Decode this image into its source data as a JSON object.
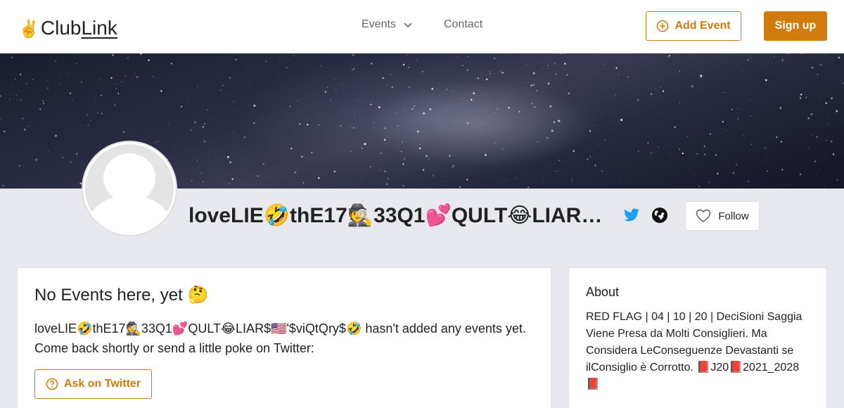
{
  "header": {
    "logo_emoji": "✌️",
    "logo_club": "Club",
    "logo_link": "Link",
    "nav_events": "Events",
    "nav_contact": "Contact",
    "add_event": "Add Event",
    "sign_up": "Sign up"
  },
  "profile": {
    "name": "loveLIE🤣thE17🕵️33Q1💕QULT😂LIAR$🇺🇸'$viQtQry$🤣",
    "follow_label": "Follow"
  },
  "events_card": {
    "title": "No Events here, yet 🤔",
    "message": "loveLIE🤣thE17🕵️33Q1💕QULT😂LIAR$🇺🇸'$viQtQry$🤣 hasn't added any events yet. Come back shortly or send a little poke on Twitter:",
    "ask_button": "Ask on Twitter"
  },
  "about_card": {
    "title": "About",
    "text": "RED FLAG | 04 | 10 | 20 | DeciSioni Saggia Viene Presa da Molti Consiglieri. Ma Considera LeConseguenze Devastanti se ilConsiglio è Corrotto. 📕J20📕2021_2028 📕"
  },
  "colors": {
    "accent": "#d07c0d",
    "twitter": "#1da1f2",
    "background": "#e7e9ee"
  },
  "icons": {
    "nav_events": "chevron-down-icon",
    "add_event": "plus-circle-icon",
    "twitter": "twitter-icon",
    "website": "globe-icon",
    "follow": "heart-icon",
    "ask": "question-circle-icon"
  }
}
